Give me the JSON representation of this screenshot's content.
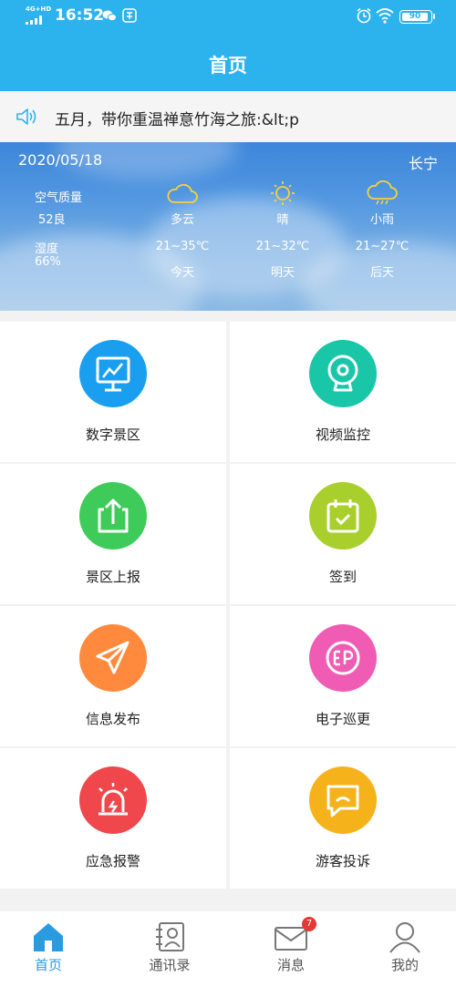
{
  "status_bar": {
    "network": "4G+HD",
    "time": "16:52",
    "battery": "90"
  },
  "header": {
    "title": "首页"
  },
  "notice": {
    "text": "五月，带你重温禅意竹海之旅:&lt;p"
  },
  "weather": {
    "date": "2020/05/18",
    "city": "长宁",
    "air_quality_label": "空气质量",
    "air_quality_value": "52良",
    "humidity_label": "湿度",
    "humidity_value": "66%",
    "days": [
      {
        "condition": "多云",
        "temp": "21~35℃",
        "label": "今天",
        "icon": "cloud-icon"
      },
      {
        "condition": "晴",
        "temp": "21~32℃",
        "label": "明天",
        "icon": "sun-icon"
      },
      {
        "condition": "小雨",
        "temp": "21~27℃",
        "label": "后天",
        "icon": "rain-icon"
      }
    ]
  },
  "menu": [
    {
      "label": "数字景区",
      "icon": "monitor-chart-icon",
      "color": "#1a9ff0"
    },
    {
      "label": "视频监控",
      "icon": "camera-icon",
      "color": "#19c6a8"
    },
    {
      "label": "景区上报",
      "icon": "upload-icon",
      "color": "#3ecb5a"
    },
    {
      "label": "签到",
      "icon": "calendar-check-icon",
      "color": "#a8cf2c"
    },
    {
      "label": "信息发布",
      "icon": "paper-plane-icon",
      "color": "#ff8a3d"
    },
    {
      "label": "电子巡更",
      "icon": "ep-icon",
      "color": "#f05cb4"
    },
    {
      "label": "应急报警",
      "icon": "alarm-light-icon",
      "color": "#f0474c"
    },
    {
      "label": "游客投诉",
      "icon": "complaint-chat-icon",
      "color": "#f5b21a"
    }
  ],
  "tabs": [
    {
      "label": "首页",
      "icon": "home-icon",
      "active": true
    },
    {
      "label": "通讯录",
      "icon": "contacts-icon",
      "active": false
    },
    {
      "label": "消息",
      "icon": "mail-icon",
      "active": false,
      "badge": "7"
    },
    {
      "label": "我的",
      "icon": "user-icon",
      "active": false
    }
  ],
  "colors": {
    "primary": "#2cb3ee",
    "tab_active": "#2a9be0"
  }
}
